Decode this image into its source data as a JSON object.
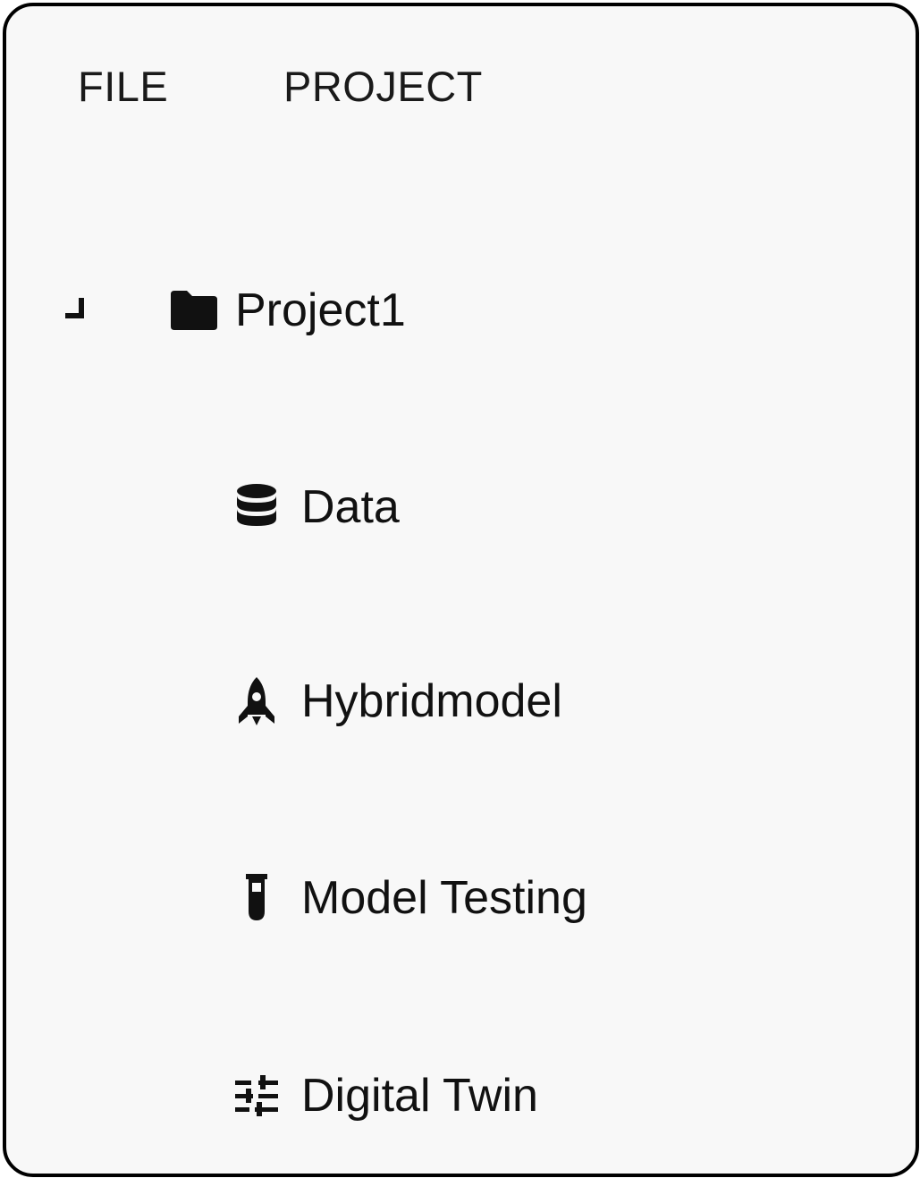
{
  "menu": {
    "file_label": "FILE",
    "project_label": "PROJECT"
  },
  "tree": {
    "root": {
      "label": "Project1",
      "icon": "folder-icon",
      "expanded": true
    },
    "children": [
      {
        "label": "Data",
        "icon": "database-icon"
      },
      {
        "label": "Hybridmodel",
        "icon": "rocket-icon"
      },
      {
        "label": "Model Testing",
        "icon": "test-tube-icon"
      },
      {
        "label": "Digital Twin",
        "icon": "sliders-icon"
      }
    ]
  },
  "colors": {
    "background": "#f8f8f8",
    "border": "#000000",
    "text": "#111111"
  }
}
